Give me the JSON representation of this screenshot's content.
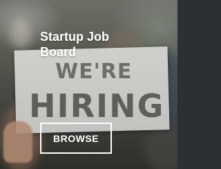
{
  "card": {
    "title": "Startup Job Board",
    "background_image": {
      "sign_line_1": "WE'RE",
      "sign_line_2": "HIRING"
    },
    "button_label": "BROWSE"
  },
  "colors": {
    "title_text": "#ffffff",
    "button_border": "#ffffff",
    "sign_background": "#c8c8c5"
  }
}
